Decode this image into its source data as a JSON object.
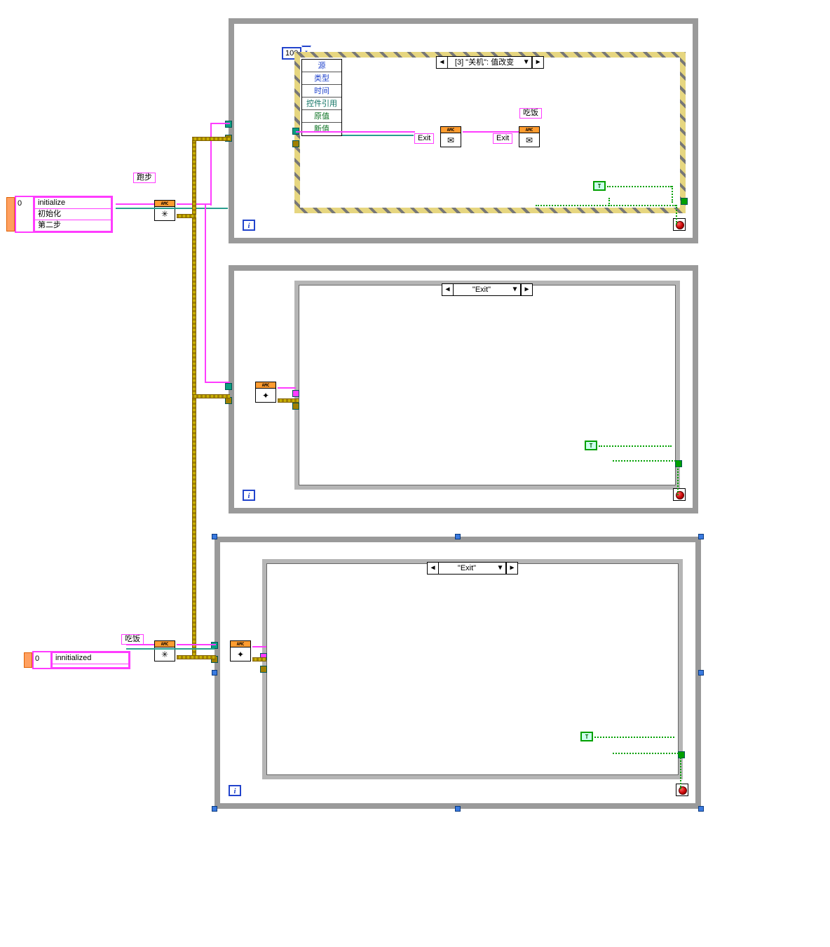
{
  "labels": {
    "paobu": "跑步",
    "chifan": "吃饭",
    "chifan2": "吃饭",
    "exit1": "Exit",
    "exit2": "Exit"
  },
  "array_top": {
    "idx": "0",
    "items": [
      "initialize",
      "初始化",
      "第二步"
    ]
  },
  "array_bot": {
    "idx": "0",
    "items": [
      "innitialized",
      ""
    ]
  },
  "loop1": {
    "timeout": "100",
    "case": "[3] \"关机\": 值改变",
    "event_fields": {
      "a": "源",
      "b": "类型",
      "c": "时间",
      "d": "控件引用",
      "e": "原值",
      "f": "新值"
    }
  },
  "loop2": {
    "case": "\"Exit\""
  },
  "loop3": {
    "case": "\"Exit\""
  },
  "amc": "AMC",
  "i": "i",
  "T": "T"
}
